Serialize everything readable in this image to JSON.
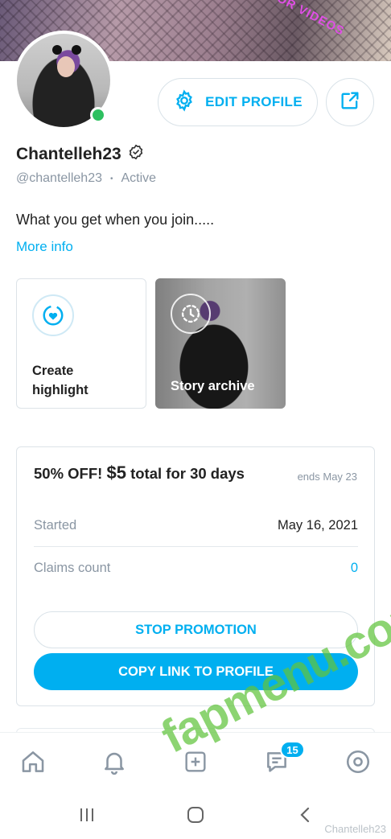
{
  "cover": {
    "overlay_text": "OR VIDEOS"
  },
  "profile": {
    "name": "Chantelleh23",
    "handle": "@chantelleh23",
    "status_separator": "•",
    "status": "Active",
    "bio": "What you get when you join.....",
    "more_info_label": "More info",
    "online": true
  },
  "actions": {
    "edit_profile_label": "EDIT PROFILE",
    "share_icon": "share-icon",
    "edit_icon": "gear-icon"
  },
  "highlights": {
    "create_label": "Create highlight",
    "archive_label": "Story archive"
  },
  "promotion": {
    "title_prefix": "50% OFF!",
    "price": "$5",
    "title_suffix": "total for 30 days",
    "ends": "ends May 23",
    "started_label": "Started",
    "started_value": "May 16, 2021",
    "claims_label": "Claims count",
    "claims_value": "0",
    "stop_label": "STOP PROMOTION",
    "copy_label": "COPY LINK TO PROFILE"
  },
  "tabbar": {
    "items": [
      "home-icon",
      "bell-icon",
      "add-post-icon",
      "messages-icon",
      "profile-icon"
    ],
    "messages_badge": "15"
  },
  "colors": {
    "accent": "#00aff0",
    "online": "#2ec060",
    "watermark": "#60c43c"
  },
  "watermark": {
    "text": "fapmenu.com",
    "corner_text": "Chantelleh23"
  }
}
